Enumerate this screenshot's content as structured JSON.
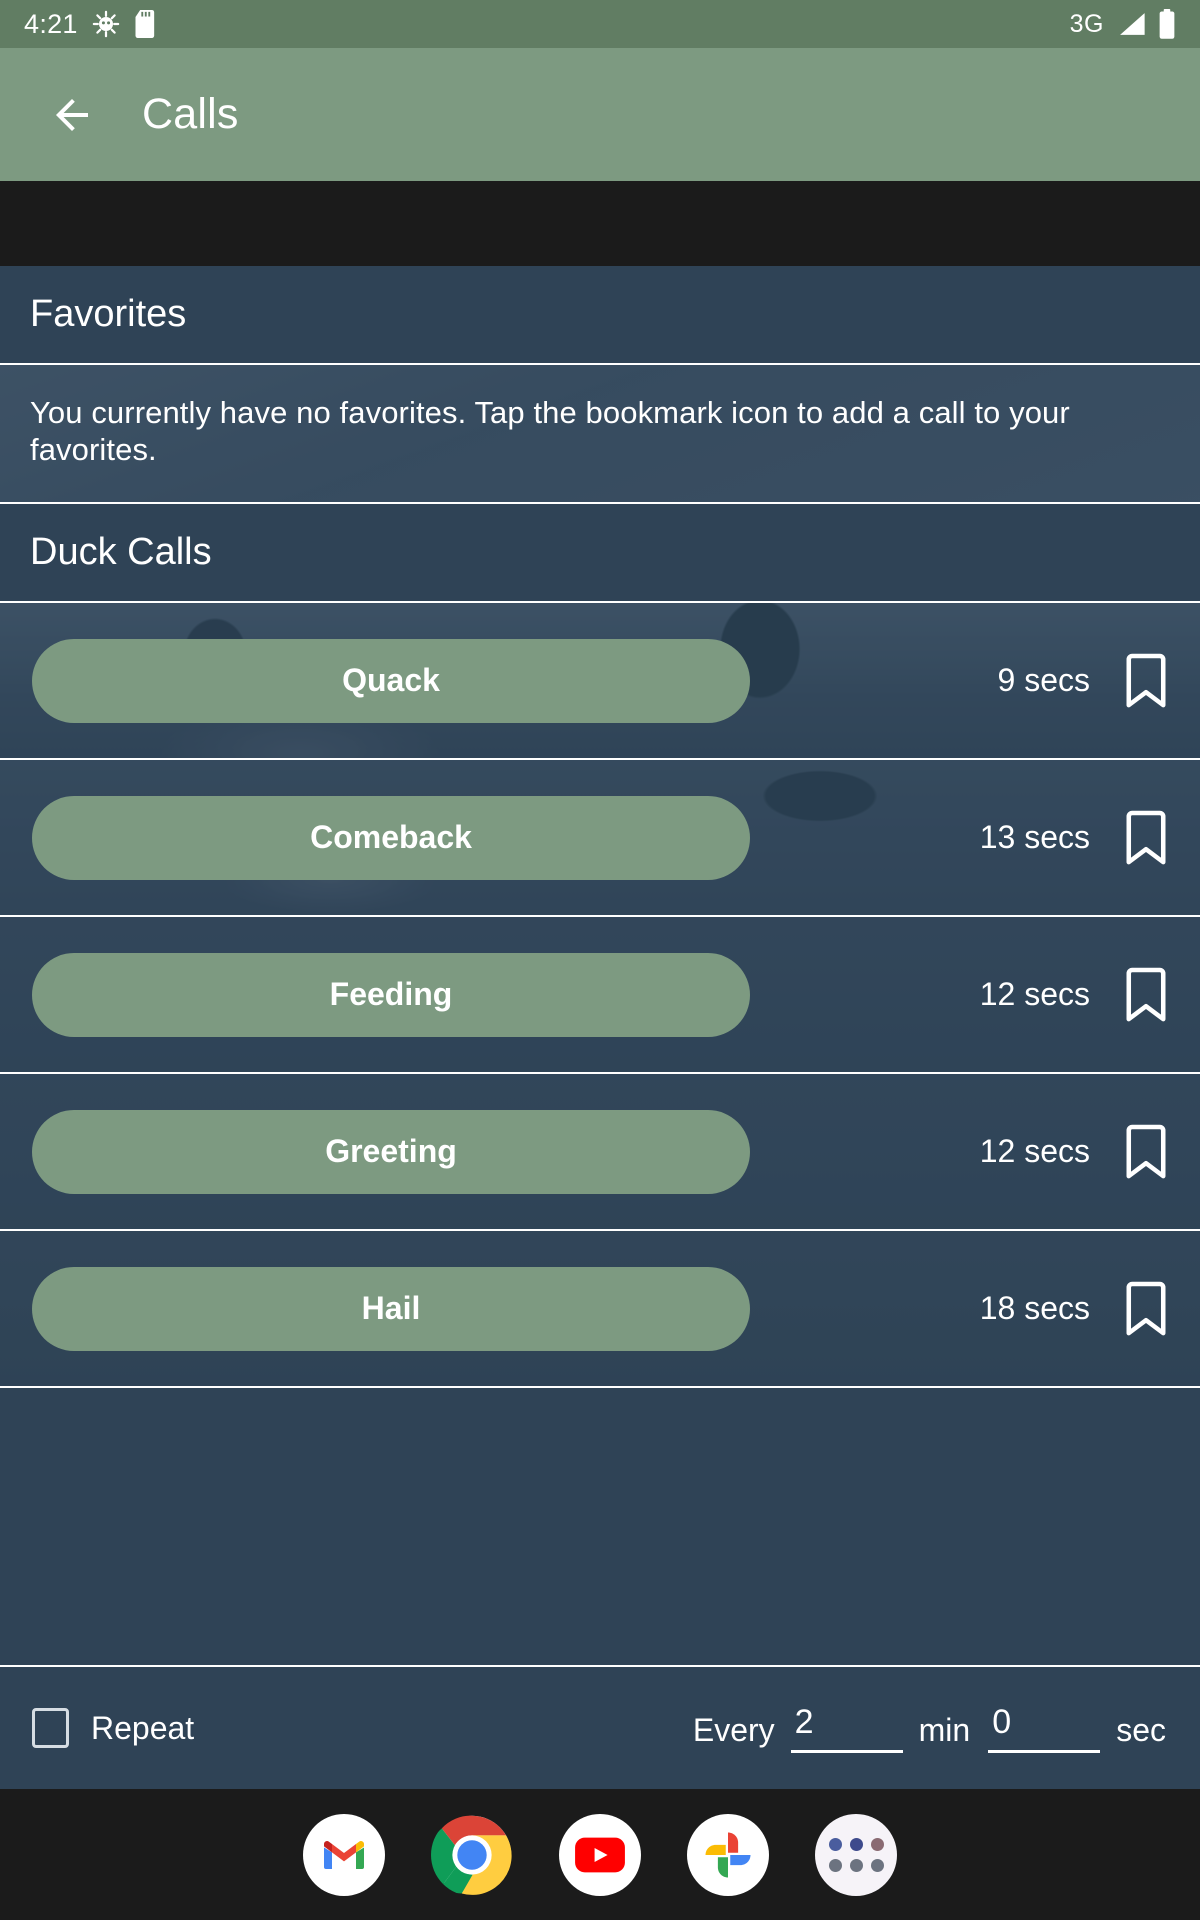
{
  "status_bar": {
    "time": "4:21",
    "network": "3G",
    "icons": [
      "android-debug-icon",
      "sd-card-icon",
      "signal-icon",
      "battery-icon"
    ]
  },
  "app_bar": {
    "back_icon": "arrow-back-icon",
    "title": "Calls"
  },
  "ad_banner": {
    "present": true
  },
  "favorites": {
    "header": "Favorites",
    "empty_message": "You currently have no favorites. Tap the bookmark icon to add a call to your favorites."
  },
  "duck_calls": {
    "header": "Duck Calls",
    "items": [
      {
        "name": "Quack",
        "duration": "9 secs",
        "bookmark_icon": "bookmark-outline-icon",
        "bookmarked": false
      },
      {
        "name": "Comeback",
        "duration": "13 secs",
        "bookmark_icon": "bookmark-outline-icon",
        "bookmarked": false
      },
      {
        "name": "Feeding",
        "duration": "12 secs",
        "bookmark_icon": "bookmark-outline-icon",
        "bookmarked": false
      },
      {
        "name": "Greeting",
        "duration": "12 secs",
        "bookmark_icon": "bookmark-outline-icon",
        "bookmarked": false
      },
      {
        "name": "Hail",
        "duration": "18 secs",
        "bookmark_icon": "bookmark-outline-icon",
        "bookmarked": false
      }
    ]
  },
  "repeat_bar": {
    "checkbox_checked": false,
    "label": "Repeat",
    "every_label": "Every",
    "minutes_value": "2",
    "minutes_unit": "min",
    "seconds_value": "0",
    "seconds_unit": "sec"
  },
  "dock": {
    "apps": [
      {
        "name": "gmail-icon"
      },
      {
        "name": "chrome-icon"
      },
      {
        "name": "youtube-icon"
      },
      {
        "name": "google-photos-icon"
      },
      {
        "name": "app-drawer-icon"
      }
    ]
  },
  "colors": {
    "accent_green": "#7d9a81",
    "status_green": "#617d63",
    "surface": "#2f4356",
    "surface_light": "#41566a",
    "dock_bg": "#1b1b1b",
    "text": "#ffffff"
  }
}
